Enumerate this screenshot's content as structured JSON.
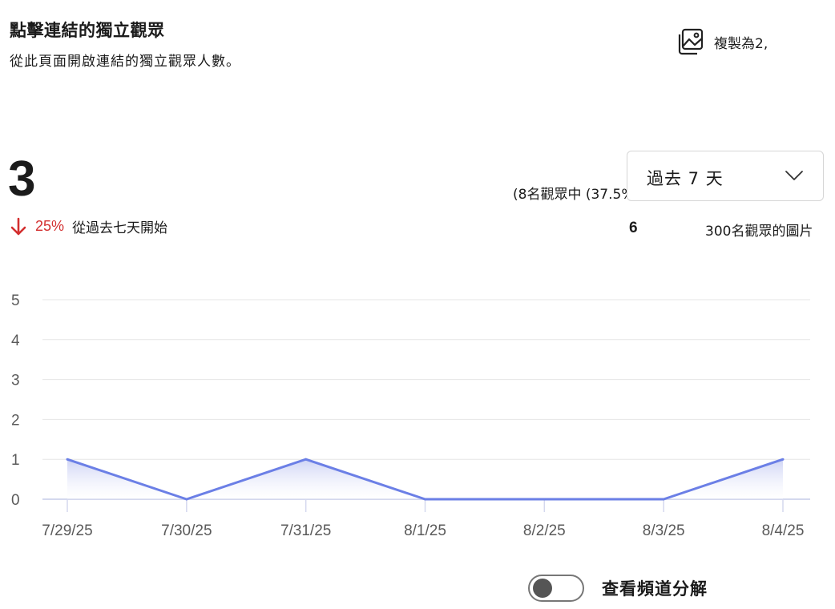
{
  "header": {
    "title": "點擊連結的獨立觀眾",
    "subtitle": "從此頁面開啟連結的獨立觀眾人數。"
  },
  "copy_button": {
    "label": "複製為2,",
    "icon": "image-copy-icon"
  },
  "summary": {
    "value": "3",
    "change_percent": "25%",
    "change_direction": "down",
    "change_text": "從過去七天開始",
    "change_color": "#d32f2f"
  },
  "stats": {
    "stat1": "(8名觀眾中 (37.5%",
    "stat2_number": "6",
    "stat2_text": "300名觀眾的圖片"
  },
  "range_dropdown": {
    "selected": "過去 7 天"
  },
  "toggle": {
    "label": "查看頻道分解",
    "state": "off"
  },
  "colors": {
    "line": "#6b7fe6",
    "area_top": "#c9cff4",
    "grid": "#e6e6e6"
  },
  "chart_data": {
    "type": "area",
    "x": [
      "7/29/25",
      "7/30/25",
      "7/31/25",
      "8/1/25",
      "8/2/25",
      "8/3/25",
      "8/4/25"
    ],
    "series": [
      {
        "values": [
          1,
          0,
          1,
          0,
          0,
          0,
          1
        ]
      }
    ],
    "ylim": [
      0,
      5
    ],
    "yticks": [
      0,
      1,
      2,
      3,
      4,
      5
    ],
    "grid": true,
    "legend": "none"
  }
}
